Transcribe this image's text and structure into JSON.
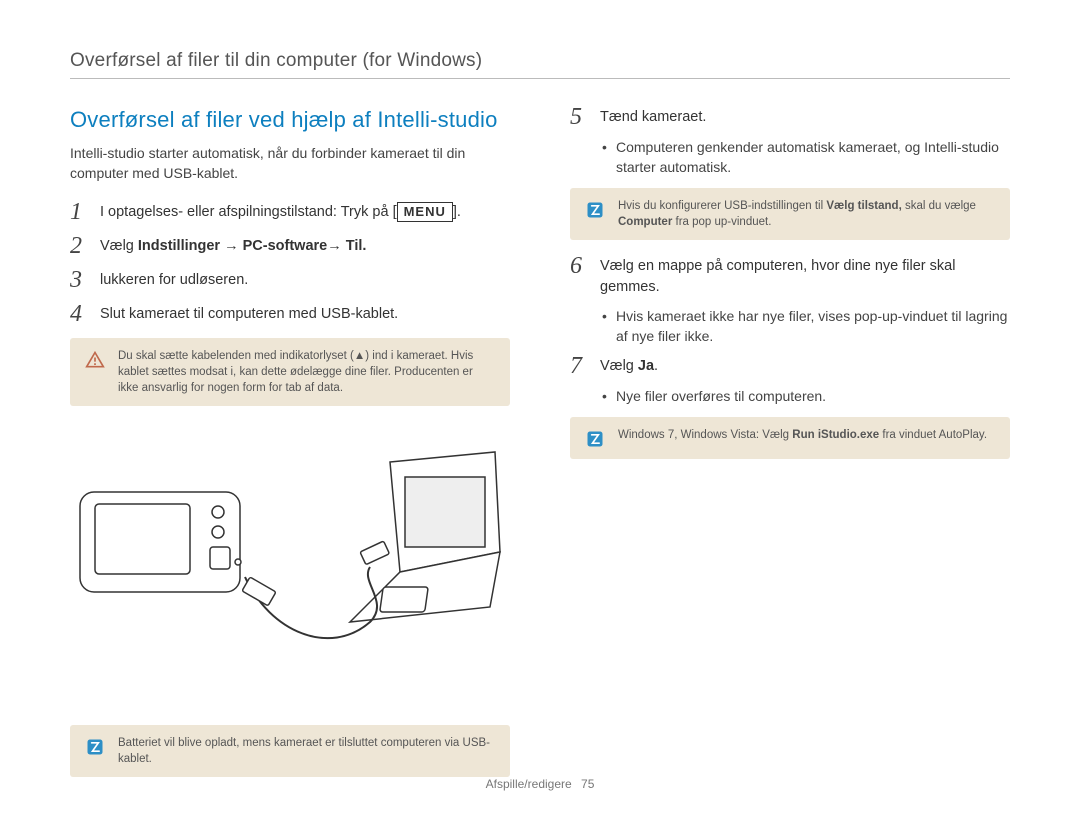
{
  "breadcrumb": "Overførsel af filer til din computer (for Windows)",
  "left": {
    "title": "Overførsel af filer ved hjælp af Intelli-studio",
    "intro": "Intelli-studio starter automatisk, når du forbinder kameraet til din computer med USB-kablet.",
    "steps": {
      "s1_prefix": "I optagelses- eller afspilningstilstand: Tryk på [",
      "s1_box": "MENU",
      "s1_suffix": "].",
      "s2_prefix": "Vælg ",
      "s2_bold": "Indstillinger → PC-software→ Til.",
      "s3": "lukkeren for udløseren.",
      "s4": "Slut kameraet til computeren med USB-kablet."
    },
    "warn": {
      "text_a": "Du skal sætte kabelenden med indikatorlyset (",
      "text_b": ") ind i kameraet. Hvis kablet sættes modsat i, kan dette ødelægge dine filer. Producenten er ikke ansvarlig for nogen form for tab af data."
    },
    "info": "Batteriet vil blive opladt, mens kameraet er tilsluttet computeren via USB-kablet."
  },
  "right": {
    "s5": "Tænd kameraet.",
    "s5_bullet": "Computeren genkender automatisk kameraet, og Intelli-studio starter automatisk.",
    "note5_a": "Hvis du konfigurerer USB-indstillingen til ",
    "note5_b1": "Vælg tilstand,",
    "note5_c": " skal du vælge ",
    "note5_b2": "Computer",
    "note5_d": " fra pop up-vinduet.",
    "s6": "Vælg en mappe på computeren, hvor dine nye filer skal gemmes.",
    "s6_bullet": "Hvis kameraet ikke har nye filer, vises pop-up-vinduet til lagring af nye filer ikke.",
    "s7_prefix": "Vælg ",
    "s7_bold": "Ja",
    "s7_suffix": ".",
    "s7_bullet": "Nye filer overføres til computeren.",
    "note7_a": "Windows 7, Windows Vista: Vælg ",
    "note7_b": "Run iStudio.exe",
    "note7_c": " fra vinduet AutoPlay."
  },
  "footer": {
    "section": "Afspille/redigere",
    "page": "75"
  },
  "icons": {
    "warn": "warning-triangle-icon",
    "info": "info-note-icon"
  }
}
